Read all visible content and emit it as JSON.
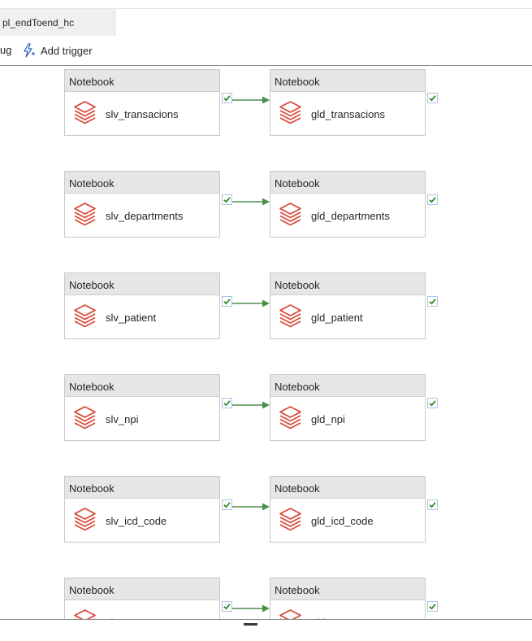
{
  "tab": {
    "title": "pl_endToend_hc"
  },
  "toolbar": {
    "truncated_label": "ug",
    "add_trigger_label": "Add trigger"
  },
  "colors": {
    "connector": "#4a8f4a",
    "success_check": "#2c8a2c",
    "notebook_icon": "#d94a3a"
  },
  "rows": [
    {
      "left": {
        "type": "Notebook",
        "name": "slv_transacions"
      },
      "right": {
        "type": "Notebook",
        "name": "gld_transacions"
      }
    },
    {
      "left": {
        "type": "Notebook",
        "name": "slv_departments"
      },
      "right": {
        "type": "Notebook",
        "name": "gld_departments"
      }
    },
    {
      "left": {
        "type": "Notebook",
        "name": "slv_patient"
      },
      "right": {
        "type": "Notebook",
        "name": "gld_patient"
      }
    },
    {
      "left": {
        "type": "Notebook",
        "name": "slv_npi"
      },
      "right": {
        "type": "Notebook",
        "name": "gld_npi"
      }
    },
    {
      "left": {
        "type": "Notebook",
        "name": "slv_icd_code"
      },
      "right": {
        "type": "Notebook",
        "name": "gld_icd_code"
      }
    },
    {
      "left": {
        "type": "Notebook",
        "name": "slv_encounters"
      },
      "right": {
        "type": "Notebook",
        "name": "gld_encounters"
      }
    }
  ]
}
